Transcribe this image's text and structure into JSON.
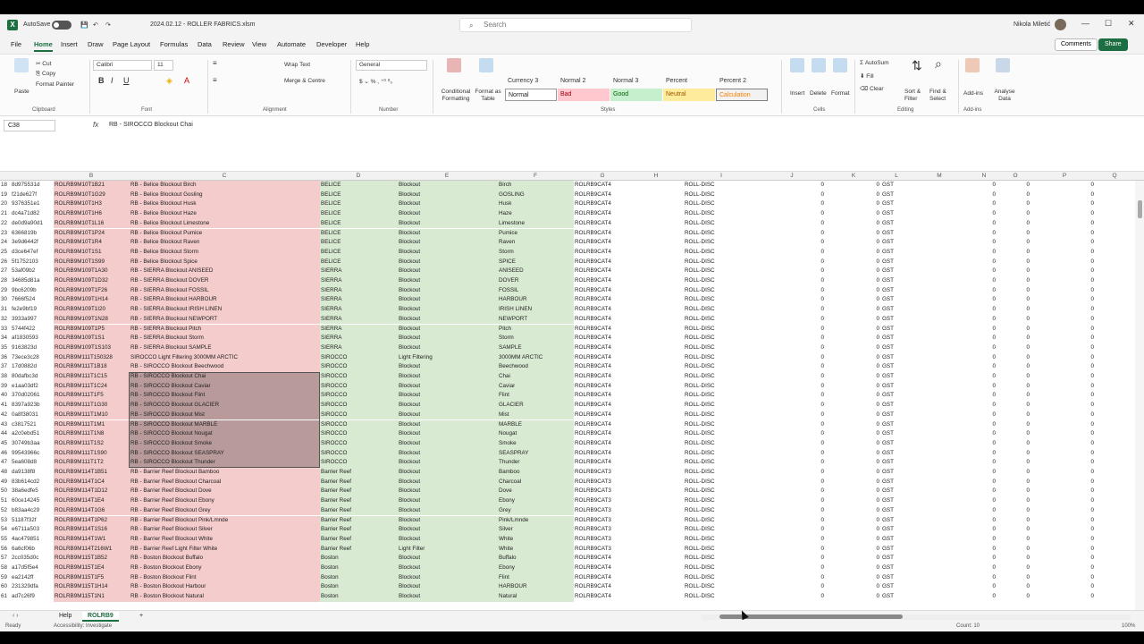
{
  "title_bar": {
    "app_logo": "X",
    "autosave": "AutoSave",
    "file": "2024.02.12 - ROLLER FABRICS.xlsm",
    "search": "Search",
    "user": "Nikola Miletić"
  },
  "menu": {
    "items": [
      "File",
      "Home",
      "Insert",
      "Draw",
      "Page Layout",
      "Formulas",
      "Data",
      "Review",
      "View",
      "Automate",
      "Developer",
      "Help"
    ],
    "comments": "Comments",
    "share": "Share"
  },
  "ribbon": {
    "clipboard": {
      "paste": "Paste",
      "cut": "Cut",
      "copy": "Copy",
      "format_painter": "Format Painter",
      "label": "Clipboard"
    },
    "font": {
      "name": "Calibri",
      "size": "11",
      "label": "Font"
    },
    "alignment": {
      "wrap": "Wrap Text",
      "merge": "Merge & Centre",
      "label": "Alignment"
    },
    "number": {
      "format": "General",
      "label": "Number"
    },
    "styles": {
      "cond": "Conditional Formatting",
      "table": "Format as Table",
      "headers": [
        "Currency 3",
        "Normal 2",
        "Normal 3",
        "Percent",
        "Percent 2"
      ],
      "cells": [
        "Normal",
        "Bad",
        "Good",
        "Neutral",
        "Calculation"
      ],
      "label": "Styles"
    },
    "cells": {
      "insert": "Insert",
      "delete": "Delete",
      "format": "Format",
      "label": "Cells"
    },
    "editing": {
      "autosum": "AutoSum",
      "fill": "Fill",
      "clear": "Clear",
      "sort": "Sort & Filter",
      "find": "Find & Select",
      "label": "Editing"
    },
    "addins": {
      "addins": "Add-ins",
      "analyse": "Analyse Data",
      "label": "Add-ins"
    }
  },
  "formula_bar": {
    "cell": "C38",
    "fx": "fx",
    "content": "RB - SIROCCO Blockout Chai"
  },
  "columns": [
    "B",
    "C",
    "D",
    "E",
    "F",
    "G",
    "H",
    "I",
    "J",
    "K",
    "L",
    "M",
    "N",
    "O",
    "P",
    "Q"
  ],
  "rows": [
    [
      "18",
      "8d975531d",
      "ROLRB9M10T1B21",
      "RB - Belice Blockout Birch",
      "BELICE",
      "Blockout",
      "Birch",
      "ROLRB9CAT4",
      "ROLL-DISC"
    ],
    [
      "19",
      "f21de627f",
      "ROLRB9M10T1G29",
      "RB - Belice Blockout Gosling",
      "BELICE",
      "Blockout",
      "GOSLING",
      "ROLRB9CAT4",
      "ROLL-DISC"
    ],
    [
      "20",
      "9376351e1",
      "ROLRB9M10T1H3",
      "RB - Belice Blockout Husk",
      "BELICE",
      "Blockout",
      "Husk",
      "ROLRB9CAT4",
      "ROLL-DISC"
    ],
    [
      "21",
      "dc4a71d82",
      "ROLRB9M10T1H6",
      "RB - Belice Blockout Haze",
      "BELICE",
      "Blockout",
      "Haze",
      "ROLRB9CAT4",
      "ROLL-DISC"
    ],
    [
      "22",
      "de0d9a90d1",
      "ROLRB9M10T1L16",
      "RB - Belice Blockout Limestone",
      "BELICE",
      "Blockout",
      "Limestone",
      "ROLRB9CAT4",
      "ROLL-DISC"
    ],
    [
      "23",
      "6366819b",
      "ROLRB9M10T1P24",
      "RB - Belice Blockout Pumice",
      "BELICE",
      "Blockout",
      "Pumice",
      "ROLRB9CAT4",
      "ROLL-DISC"
    ],
    [
      "24",
      "3e9d6442f",
      "ROLRB9M10T1R4",
      "RB - Belice Blockout Raven",
      "BELICE",
      "Blockout",
      "Raven",
      "ROLRB9CAT4",
      "ROLL-DISC"
    ],
    [
      "25",
      "d3ce647ef",
      "ROLRB9M10T1S1",
      "RB - Belice Blockout Storm",
      "BELICE",
      "Blockout",
      "Storm",
      "ROLRB9CAT4",
      "ROLL-DISC"
    ],
    [
      "26",
      "5f1752103",
      "ROLRB9M10T1S99",
      "RB - Belice Blockout Spice",
      "BELICE",
      "Blockout",
      "SPICE",
      "ROLRB9CAT4",
      "ROLL-DISC"
    ],
    [
      "27",
      "53af09b2",
      "ROLRB9M109T1A30",
      "RB - SIERRA Blockout ANISEED",
      "SIERRA",
      "Blockout",
      "ANISEED",
      "ROLRB9CAT4",
      "ROLL-DISC"
    ],
    [
      "28",
      "34685d81a",
      "ROLRB9M109T1D32",
      "RB - SIERRA Blockout DOVER",
      "SIERRA",
      "Blockout",
      "DOVER",
      "ROLRB9CAT4",
      "ROLL-DISC"
    ],
    [
      "29",
      "9bc6209b",
      "ROLRB9M109T1F26",
      "RB - SIERRA Blockout FOSSIL",
      "SIERRA",
      "Blockout",
      "FOSSIL",
      "ROLRB9CAT4",
      "ROLL-DISC"
    ],
    [
      "30",
      "7666f524",
      "ROLRB9M109T1H14",
      "RB - SIERRA Blockout HARBOUR",
      "SIERRA",
      "Blockout",
      "HARBOUR",
      "ROLRB9CAT4",
      "ROLL-DISC"
    ],
    [
      "31",
      "fe2e9bf19",
      "ROLRB9M109T1I20",
      "RB - SIERRA Blockout IRISH LINEN",
      "SIERRA",
      "Blockout",
      "IRISH LINEN",
      "ROLRB9CAT4",
      "ROLL-DISC"
    ],
    [
      "32",
      "3933a997",
      "ROLRB9M109T1N28",
      "RB - SIERRA Blockout NEWPORT",
      "SIERRA",
      "Blockout",
      "NEWPORT",
      "ROLRB9CAT4",
      "ROLL-DISC"
    ],
    [
      "33",
      "5744f422",
      "ROLRB9M109T1P5",
      "RB - SIERRA Blockout Pitch",
      "SIERRA",
      "Blockout",
      "Pitch",
      "ROLRB9CAT4",
      "ROLL-DISC"
    ],
    [
      "34",
      "af1830593",
      "ROLRB9M109T1S1",
      "RB - SIERRA Blockout Storm",
      "SIERRA",
      "Blockout",
      "Storm",
      "ROLRB9CAT4",
      "ROLL-DISC"
    ],
    [
      "35",
      "9163823d",
      "ROLRB9M109T1S103",
      "RB - SIERRA Blockout SAMPLE",
      "SIERRA",
      "Blockout",
      "SAMPLE",
      "ROLRB9CAT4",
      "ROLL-DISC"
    ],
    [
      "36",
      "73ece3c28",
      "ROLRB9M111T150328",
      "SIROCCO Light Filtering 3000MM ARCTIC",
      "SIROCCO",
      "Light Filtering",
      "3000MM ARCTIC",
      "ROLRB9CAT4",
      "ROLL-DISC"
    ],
    [
      "37",
      "17d0882d",
      "ROLRB9M111T1B18",
      "RB - SIROCCO Blockout Beechwood",
      "SIROCCO",
      "Blockout",
      "Beechwood",
      "ROLRB9CAT4",
      "ROLL-DISC"
    ],
    [
      "38",
      "80dafbc3d",
      "ROLRB9M111T1C15",
      "RB - SIROCCO Blockout Chai",
      "SIROCCO",
      "Blockout",
      "Chai",
      "ROLRB9CAT4",
      "ROLL-DISC"
    ],
    [
      "39",
      "e1aa03df2",
      "ROLRB9M111T1C24",
      "RB - SIROCCO Blockout Caviar",
      "SIROCCO",
      "Blockout",
      "Caviar",
      "ROLRB9CAT4",
      "ROLL-DISC"
    ],
    [
      "40",
      "370d02061",
      "ROLRB9M111T1F5",
      "RB - SIROCCO Blockout Flint",
      "SIROCCO",
      "Blockout",
      "Flint",
      "ROLRB9CAT4",
      "ROLL-DISC"
    ],
    [
      "41",
      "8397a923b",
      "ROLRB9M111T1G30",
      "RB - SIROCCO Blockout GLACIER",
      "SIROCCO",
      "Blockout",
      "GLACIER",
      "ROLRB9CAT4",
      "ROLL-DISC"
    ],
    [
      "42",
      "0a8f38031",
      "ROLRB9M111T1M10",
      "RB - SIROCCO Blockout Mist",
      "SIROCCO",
      "Blockout",
      "Mist",
      "ROLRB9CAT4",
      "ROLL-DISC"
    ],
    [
      "43",
      "c3817521",
      "ROLRB9M111T1M1",
      "RB - SIROCCO Blockout MARBLE",
      "SIROCCO",
      "Blockout",
      "MARBLE",
      "ROLRB9CAT4",
      "ROLL-DISC"
    ],
    [
      "44",
      "a2c0ebd51",
      "ROLRB9M111T1N8",
      "RB - SIROCCO Blockout Nougat",
      "SIROCCO",
      "Blockout",
      "Nougat",
      "ROLRB9CAT4",
      "ROLL-DISC"
    ],
    [
      "45",
      "30749b3aa",
      "ROLRB9M111T1S2",
      "RB - SIROCCO Blockout Smoke",
      "SIROCCO",
      "Blockout",
      "Smoke",
      "ROLRB9CAT4",
      "ROLL-DISC"
    ],
    [
      "46",
      "99543966c",
      "ROLRB9M111T1S90",
      "RB - SIROCCO Blockout SEASPRAY",
      "SIROCCO",
      "Blockout",
      "SEASPRAY",
      "ROLRB9CAT4",
      "ROLL-DISC"
    ],
    [
      "47",
      "5ea608d8",
      "ROLRB9M111T1T2",
      "RB - SIROCCO Blockout Thunder",
      "SIROCCO",
      "Blockout",
      "Thunder",
      "ROLRB9CAT4",
      "ROLL-DISC"
    ],
    [
      "48",
      "da9138f8",
      "ROLRB9M114T1B51",
      "RB - Barrier Reef Blockout Bamboo",
      "Barrier Reef",
      "Blockout",
      "Bamboo",
      "ROLRB9CAT3",
      "ROLL-DISC"
    ],
    [
      "49",
      "83b614cd2",
      "ROLRB9M114T1C4",
      "RB - Barrier Reef Blockout Charcoal",
      "Barrier Reef",
      "Blockout",
      "Charcoal",
      "ROLRB9CAT3",
      "ROLL-DISC"
    ],
    [
      "50",
      "38a6edfe5",
      "ROLRB9M114T1D12",
      "RB - Barrier Reef Blockout Dove",
      "Barrier Reef",
      "Blockout",
      "Dove",
      "ROLRB9CAT3",
      "ROLL-DISC"
    ],
    [
      "51",
      "60ce14245",
      "ROLRB9M114T1E4",
      "RB - Barrier Reef Blockout Ebony",
      "Barrier Reef",
      "Blockout",
      "Ebony",
      "ROLRB9CAT3",
      "ROLL-DISC"
    ],
    [
      "52",
      "b83aa4c29",
      "ROLRB9M114T1G6",
      "RB - Barrier Reef Blockout Grey",
      "Barrier Reef",
      "Blockout",
      "Grey",
      "ROLRB9CAT3",
      "ROLL-DISC"
    ],
    [
      "53",
      "51187f32f",
      "ROLRB9M114T1P62",
      "RB - Barrier Reef Blockout Pink/Lmnde",
      "Barrier Reef",
      "Blockout",
      "Pink/Lmnde",
      "ROLRB9CAT3",
      "ROLL-DISC"
    ],
    [
      "54",
      "e6711a503",
      "ROLRB9M114T1S16",
      "RB - Barrier Reef Blockout Silver",
      "Barrier Reef",
      "Blockout",
      "Silver",
      "ROLRB9CAT3",
      "ROLL-DISC"
    ],
    [
      "55",
      "4ac479851",
      "ROLRB9M114T1W1",
      "RB - Barrier Reef Blockout White",
      "Barrier Reef",
      "Blockout",
      "White",
      "ROLRB9CAT3",
      "ROLL-DISC"
    ],
    [
      "56",
      "6a6cf06b",
      "ROLRB9M114T216W1",
      "RB - Barrier Reef Light Filter White",
      "Barrier Reef",
      "Light Filter",
      "White",
      "ROLRB9CAT3",
      "ROLL-DISC"
    ],
    [
      "57",
      "2cc035d0c",
      "ROLRB9M115T1B52",
      "RB - Boston Blockout Buffalo",
      "Boston",
      "Blockout",
      "Buffalo",
      "ROLRB9CAT4",
      "ROLL-DISC"
    ],
    [
      "58",
      "a17d5f5e4",
      "ROLRB9M115T1E4",
      "RB - Boston Blockout Ebony",
      "Boston",
      "Blockout",
      "Ebony",
      "ROLRB9CAT4",
      "ROLL-DISC"
    ],
    [
      "59",
      "ea2142ff",
      "ROLRB9M115T1F5",
      "RB - Boston Blockout Flint",
      "Boston",
      "Blockout",
      "Flint",
      "ROLRB9CAT4",
      "ROLL-DISC"
    ],
    [
      "60",
      "231329dfa",
      "ROLRB9M115T1H14",
      "RB - Boston Blockout Harbour",
      "Boston",
      "Blockout",
      "HARBOUR",
      "ROLRB9CAT4",
      "ROLL-DISC"
    ],
    [
      "61",
      "ad7c26f9",
      "ROLRB9M115T1N1",
      "RB - Boston Blockout Natural",
      "Boston",
      "Blockout",
      "Natural",
      "ROLRB9CAT4",
      "ROLL-DISC"
    ]
  ],
  "num_values": {
    "j": "0",
    "k": "0",
    "gst": "GST",
    "n": "0",
    "o": "0",
    "q": "0"
  },
  "sheet_tabs": {
    "help": "Help",
    "active": "ROLRB9",
    "add": "+"
  },
  "status": {
    "ready": "Ready",
    "accessibility": "Accessibility: Investigate",
    "count": "Count: 10",
    "zoom": "100%"
  }
}
